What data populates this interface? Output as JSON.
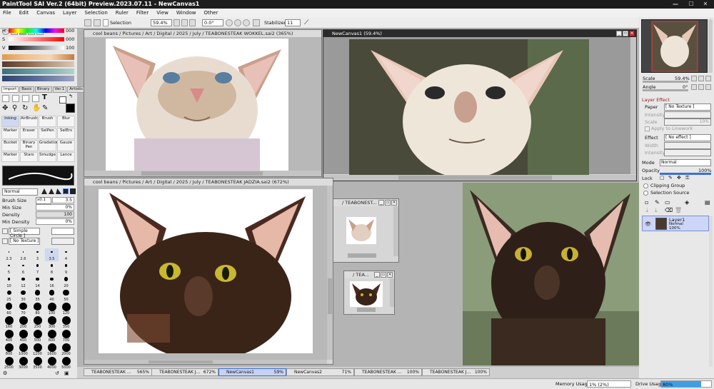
{
  "app": {
    "title": "PaintTool SAI Ver.2 (64bit) Preview.2023.07.11 - NewCanvas1",
    "win_min": "—",
    "win_max": "☐",
    "win_close": "✕"
  },
  "menu": [
    "File",
    "Edit",
    "Canvas",
    "Layer",
    "Selection",
    "Ruler",
    "Filter",
    "View",
    "Window",
    "Other"
  ],
  "toolbar": {
    "selection_label": "Selection",
    "zoom": "59.4%",
    "angle": "0.0°",
    "stabilizer_label": "Stabilizer",
    "stabilizer_value": "11"
  },
  "color": {
    "h_value": "000",
    "s_value": "000",
    "v_value": "100",
    "h_label": "H",
    "s_label": "S",
    "v_label": "V"
  },
  "tool_tabs": [
    "Import",
    "Basic",
    "Binary",
    "Ver.1",
    "Artistic"
  ],
  "brushes": [
    [
      "Inking",
      "AirBrush",
      "Brush",
      "Blur"
    ],
    [
      "Marker",
      "Eraser",
      "SelPen",
      "SelErs"
    ],
    [
      "Bucket",
      "Binary Pen",
      "Gradation",
      "Gauze"
    ],
    [
      "Marker",
      "Stars",
      "Smudge",
      "Lance"
    ]
  ],
  "brush_settings": {
    "blend_mode": "Normal",
    "size_label": "Brush Size",
    "size_mult": "x0.1",
    "size_value": "3.5",
    "min_size_label": "Min Size",
    "min_size_value": "0%",
    "density_label": "Density",
    "density_value": "100",
    "min_density_label": "Min Density",
    "min_density_value": "0%",
    "shape": "[ Simple Circle ]",
    "texture": "[ No Texture ]"
  },
  "brush_sizes": [
    "2.3",
    "2.6",
    "3",
    "3.5",
    "4",
    "5",
    "6",
    "7",
    "8",
    "9",
    "10",
    "12",
    "14",
    "16",
    "20",
    "25",
    "30",
    "35",
    "40",
    "50",
    "60",
    "70",
    "80",
    "100",
    "120",
    "160",
    "200",
    "250",
    "300",
    "350",
    "400",
    "450",
    "500",
    "600",
    "700",
    "800",
    "1000",
    "1200",
    "1600",
    "2000",
    "2500",
    "3000",
    "3500",
    "4000",
    "5000"
  ],
  "canvases": {
    "top_left": {
      "title": "cool beans / Pictures / Art / Digital / 2025 / July / TEABONESTEAK WOKKEL.sai2 (365%)"
    },
    "bottom_left": {
      "title": "cool beans / Pictures / Art / Digital / 2025 / July / TEABONESTEAK JADZIA.sai2 (672%)"
    },
    "active": {
      "title": "NewCanvas1 (59.4%)"
    },
    "mini1": {
      "title": "/ TEABONEST..."
    },
    "mini2": {
      "title": "/ TEA..."
    }
  },
  "navigator": {
    "scale_label": "Scale",
    "scale_value": "59.4%",
    "angle_label": "Angle",
    "angle_value": "0°"
  },
  "layer_effect": {
    "header": "Layer Effect",
    "paper_label": "Paper",
    "paper_value": "[ No Texture ]",
    "intensity_label": "Intensity",
    "scale_label": "Scale",
    "scale_value": "10%",
    "apply_label": "Apply to Linework",
    "effect_label": "Effect",
    "effect_value": "[ No effect ]",
    "width_label": "Width",
    "intensity2_label": "Intensity"
  },
  "layer_props": {
    "mode_label": "Mode",
    "mode_value": "Normal",
    "opacity_label": "Opacity",
    "opacity_value": "100%",
    "lock_label": "Lock",
    "clipping_label": "Clipping Group",
    "selsource_label": "Selection Source"
  },
  "layers": [
    {
      "name": "Layer1",
      "mode": "Normal",
      "opacity": "100%"
    }
  ],
  "tabs": [
    {
      "name": "TEABONESTEAK ...",
      "pct": "565%"
    },
    {
      "name": "TEABONESTEAK J...",
      "pct": "672%"
    },
    {
      "name": "NewCanvas1",
      "pct": "59%"
    },
    {
      "name": "NewCanvas2",
      "pct": "71%"
    },
    {
      "name": "TEABONESTEAK ...",
      "pct": "100%"
    },
    {
      "name": "TEABONESTEAK J...",
      "pct": "100%"
    }
  ],
  "status": {
    "memory_label": "Memory Usage",
    "memory_value": "1% (2%)",
    "drive_label": "Drive Usage",
    "drive_value": "80%"
  },
  "colors": {
    "accent": "#3b6fd8",
    "titlebar": "#1d1d1d"
  }
}
